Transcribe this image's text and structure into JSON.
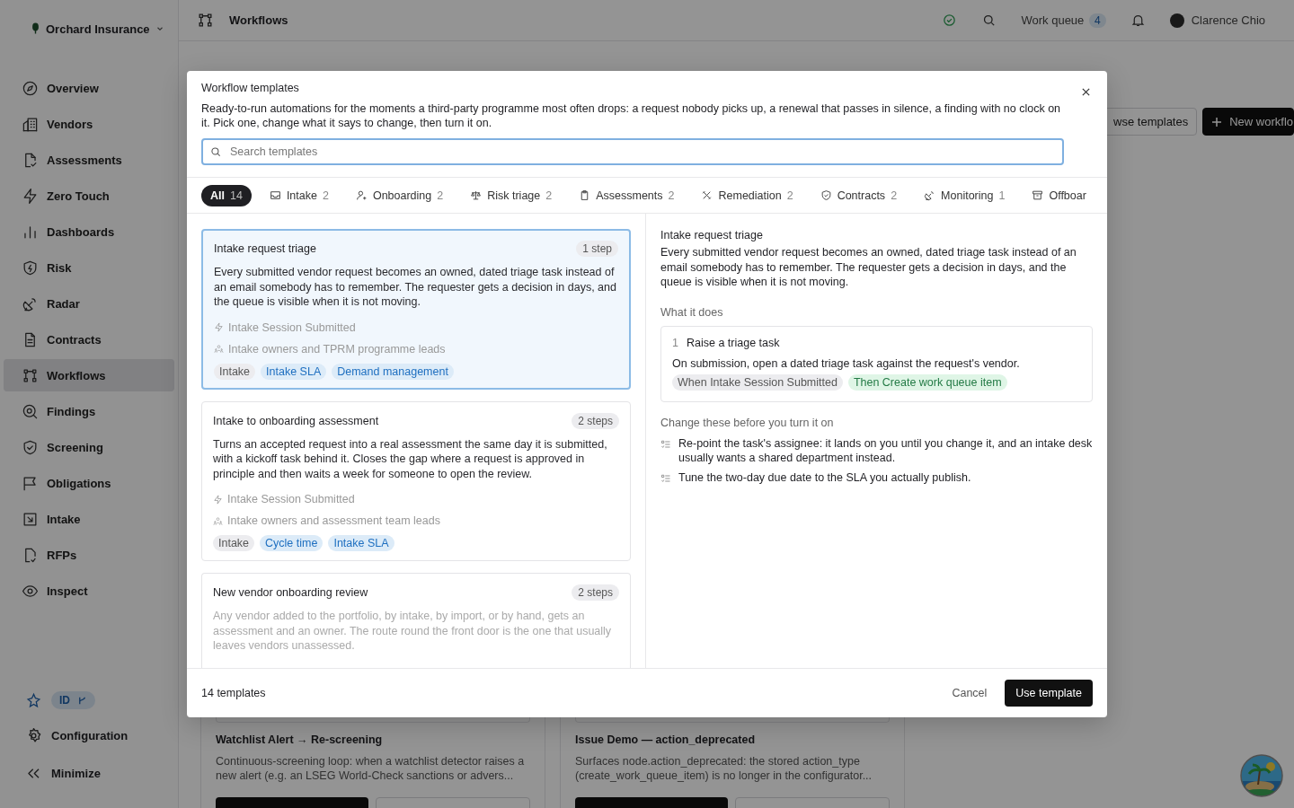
{
  "org": {
    "name": "Orchard Insurance"
  },
  "sidebar": {
    "items": [
      {
        "label": "Overview",
        "selected": false
      },
      {
        "label": "Vendors",
        "selected": false
      },
      {
        "label": "Assessments",
        "selected": false
      },
      {
        "label": "Zero Touch",
        "selected": false
      },
      {
        "label": "Dashboards",
        "selected": false
      },
      {
        "label": "Risk",
        "selected": false
      },
      {
        "label": "Radar",
        "selected": false
      },
      {
        "label": "Contracts",
        "selected": false
      },
      {
        "label": "Workflows",
        "selected": true
      },
      {
        "label": "Findings",
        "selected": false
      },
      {
        "label": "Screening",
        "selected": false
      },
      {
        "label": "Obligations",
        "selected": false
      },
      {
        "label": "Intake",
        "selected": false
      },
      {
        "label": "RFPs",
        "selected": false
      },
      {
        "label": "Inspect",
        "selected": false
      }
    ],
    "badge": "ID",
    "footer": [
      {
        "label": "Configuration"
      },
      {
        "label": "Minimize"
      }
    ]
  },
  "header": {
    "title": "Workflows",
    "work_queue": {
      "label": "Work queue",
      "count": "4"
    },
    "user": "Clarence Chio"
  },
  "page": {
    "actions": [
      {
        "label": "wse templates",
        "kind": "secondary"
      },
      {
        "label": "New workflo",
        "kind": "primary"
      }
    ],
    "cards": [
      {
        "title": "Watchlist Alert → Re-screening",
        "description": "Continuous-screening loop: when a watchlist detector raises a new alert (e.g. an LSEG World-Check sanctions or advers..."
      },
      {
        "title": "Issue Demo — action_deprecated",
        "description": "Surfaces node.action_deprecated: the stored action_type (create_work_queue_item) is no longer in the configurator..."
      }
    ]
  },
  "modal": {
    "title": "Workflow templates",
    "description": "Ready-to-run automations for the moments a third-party programme most often drops: a request nobody picks up, a renewal that passes in silence, a finding with no clock on it. Pick one, change what it says to change, then turn it on.",
    "search": {
      "placeholder": "Search templates"
    },
    "tabs": [
      {
        "label": "All",
        "count": "14",
        "selected": true
      },
      {
        "label": "Intake",
        "count": "2",
        "selected": false
      },
      {
        "label": "Onboarding",
        "count": "2",
        "selected": false
      },
      {
        "label": "Risk triage",
        "count": "2",
        "selected": false
      },
      {
        "label": "Assessments",
        "count": "2",
        "selected": false
      },
      {
        "label": "Remediation",
        "count": "2",
        "selected": false
      },
      {
        "label": "Contracts",
        "count": "2",
        "selected": false
      },
      {
        "label": "Monitoring",
        "count": "1",
        "selected": false
      },
      {
        "label": "Offboar",
        "selected": false
      }
    ],
    "templates": [
      {
        "title": "Intake request triage",
        "steps": "1 step",
        "selected": true,
        "description": "Every submitted vendor request becomes an owned, dated triage task instead of an email somebody has to remember. The requester gets a decision in days, and the queue is visible when it is not moving.",
        "trigger": "Intake Session Submitted",
        "audience": "Intake owners and TPRM programme leads",
        "tags": [
          {
            "label": "Intake",
            "kind": "category"
          },
          {
            "label": "Intake SLA",
            "kind": "topic"
          },
          {
            "label": "Demand management",
            "kind": "topic"
          }
        ]
      },
      {
        "title": "Intake to onboarding assessment",
        "steps": "2 steps",
        "selected": false,
        "description": "Turns an accepted request into a real assessment the same day it is submitted, with a kickoff task behind it. Closes the gap where a request is approved in principle and then waits a week for someone to open the review.",
        "trigger": "Intake Session Submitted",
        "audience": "Intake owners and assessment team leads",
        "tags": [
          {
            "label": "Intake",
            "kind": "category"
          },
          {
            "label": "Cycle time",
            "kind": "topic"
          },
          {
            "label": "Intake SLA",
            "kind": "topic"
          }
        ]
      },
      {
        "title": "New vendor onboarding review",
        "steps": "2 steps",
        "selected": false,
        "description": "Any vendor added to the portfolio, by intake, by import, or by hand, gets an assessment and an owner. The route round the front door is the one that usually leaves vendors unassessed."
      }
    ],
    "detail": {
      "title": "Intake request triage",
      "description": "Every submitted vendor request becomes an owned, dated triage task instead of an email somebody has to remember. The requester gets a decision in days, and the queue is visible when it is not moving.",
      "what_heading": "What it does",
      "steps": [
        {
          "number": "1",
          "title": "Raise a triage task",
          "description": "On submission, open a dated triage task against the request's vendor.",
          "chips": [
            {
              "label": "When Intake Session Submitted",
              "kind": "trigger"
            },
            {
              "label": "Then Create work queue item",
              "kind": "action"
            }
          ]
        }
      ],
      "change_heading": "Change these before you turn it on",
      "changes": [
        "Re-point the task's assignee: it lands on you until you change it, and an intake desk usually wants a shared department instead.",
        "Tune the two-day due date to the SLA you actually publish."
      ]
    },
    "footer": {
      "count": "14 templates",
      "cancel": "Cancel",
      "confirm": "Use template"
    }
  }
}
